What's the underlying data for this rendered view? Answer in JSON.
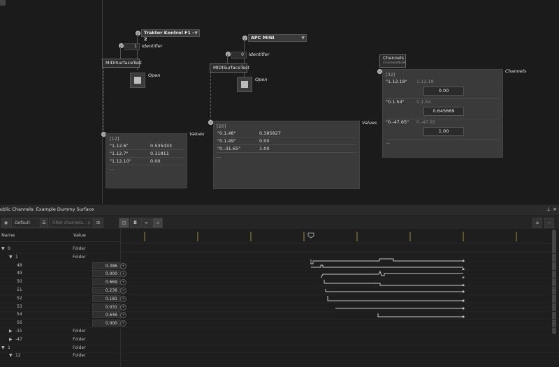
{
  "graph": {
    "node1": {
      "device": "Traktor Kontrol F1 - 2",
      "identifier_value": "1",
      "identifier_label": "Identifier",
      "title": "MIDISurfaceTest",
      "open_label": "Open",
      "values_label": "Values",
      "count": "[12]",
      "rows": [
        {
          "k": "\"1.12.6\"",
          "v": "0.535433"
        },
        {
          "k": "\"1.12.7\"",
          "v": "0.11811"
        },
        {
          "k": "\"1.12.10\"",
          "v": "0.00"
        }
      ],
      "more": "..."
    },
    "node2": {
      "device": "APC MINI",
      "identifier_value": "0",
      "identifier_label": "Identifier",
      "title": "MIDISurfaceTest",
      "open_label": "Open",
      "values_label": "Values",
      "count": "[20]",
      "rows": [
        {
          "k": "\"0.1.48\"",
          "v": "0.385827"
        },
        {
          "k": "\"0.1.49\"",
          "v": "0.00"
        },
        {
          "k": "\"0.-31.65\"",
          "v": "1.00"
        }
      ],
      "more": "..."
    },
    "channels": {
      "title": "Channels",
      "subtitle": "ChannelsNode",
      "label": "Channels",
      "count": "[32]",
      "rows": [
        {
          "k": "\"1.12.18\"",
          "hint": "1.12.18",
          "v": "0.00"
        },
        {
          "k": "\"0.1.54\"",
          "hint": "0.1.54",
          "v": "0.645669"
        },
        {
          "k": "\"0.-47.65\"",
          "hint": "0.-47.65",
          "v": "1.00"
        }
      ],
      "more": "..."
    }
  },
  "panel": {
    "title": "Public Channels: Example Dummy Surface",
    "preset": "Default",
    "filter_placeholder": "Filter channels...",
    "filter_clear": "x",
    "col_name": "Name",
    "col_value": "Value",
    "rows": [
      {
        "name": "0",
        "value": "Folder",
        "level": 0,
        "folder": true,
        "expanded": true
      },
      {
        "name": "1",
        "value": "Folder",
        "level": 1,
        "folder": true,
        "expanded": true
      },
      {
        "name": "48",
        "value": "0.386",
        "level": 2
      },
      {
        "name": "49",
        "value": "0.000",
        "level": 2
      },
      {
        "name": "50",
        "value": "0.669",
        "level": 2
      },
      {
        "name": "51",
        "value": "0.236",
        "level": 2
      },
      {
        "name": "52",
        "value": "0.181",
        "level": 2
      },
      {
        "name": "53",
        "value": "0.031",
        "level": 2
      },
      {
        "name": "54",
        "value": "0.646",
        "level": 2
      },
      {
        "name": "56",
        "value": "0.000",
        "level": 2
      },
      {
        "name": "-31",
        "value": "Folder",
        "level": 1,
        "folder": true,
        "expanded": false
      },
      {
        "name": "-47",
        "value": "Folder",
        "level": 1,
        "folder": true,
        "expanded": false
      },
      {
        "name": "1",
        "value": "Folder",
        "level": 0,
        "folder": true,
        "expanded": true
      },
      {
        "name": "12",
        "value": "Folder",
        "level": 1,
        "folder": true,
        "expanded": true
      }
    ]
  },
  "icons": {
    "eye": "eye-icon",
    "menu": "menu-icon",
    "tree": "tree-view-icon",
    "camera": "camera-icon",
    "link": "link-icon",
    "wave": "waveform-icon",
    "pin": "pin-icon",
    "close": "close-icon",
    "more": "more-icon"
  },
  "colors": {
    "background": "#1b1b1b",
    "panel": "#3a3a3a",
    "trace": "#c8c8c8"
  }
}
